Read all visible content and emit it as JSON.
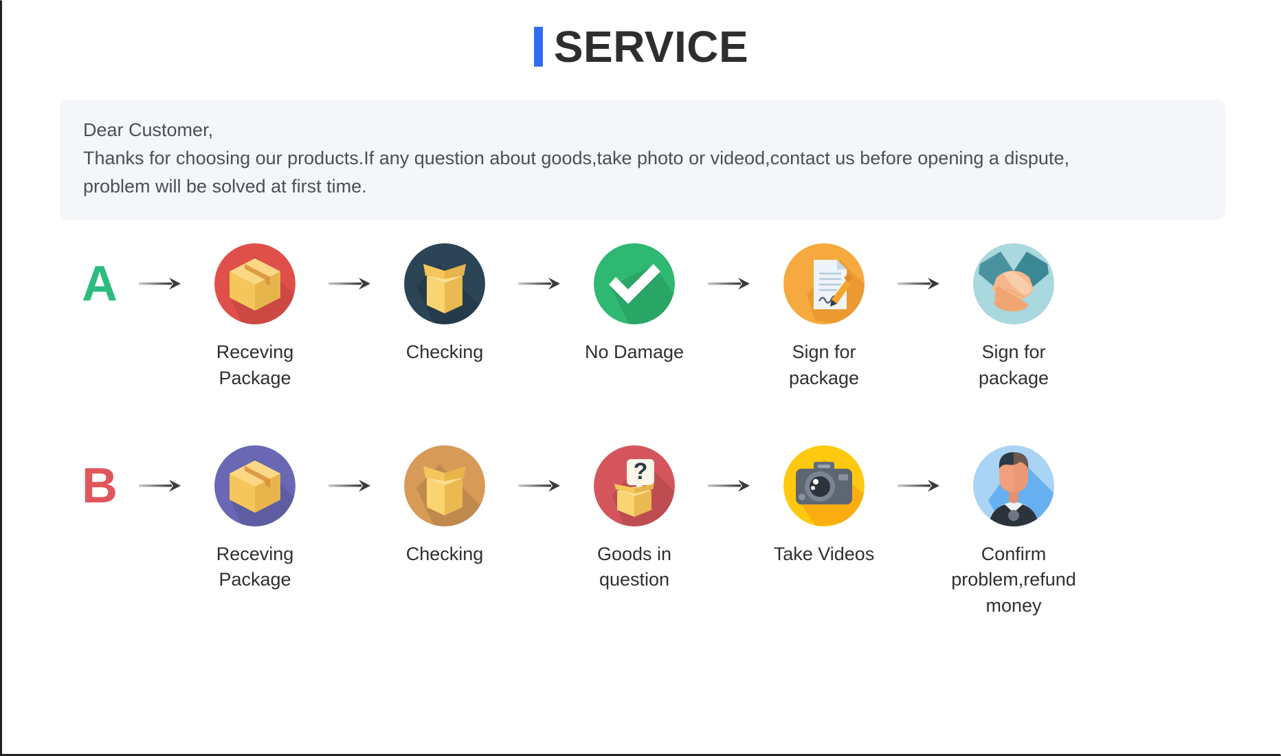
{
  "header": {
    "title": "SERVICE",
    "accent_color": "#2f6ef5"
  },
  "notice": {
    "line1": "Dear Customer,",
    "line2": "Thanks for choosing our products.If any question about goods,take photo or videod,contact us before opening a dispute,",
    "line3": "problem will be solved at first time.",
    "background_color": "#f4f6fa"
  },
  "flows": [
    {
      "letter": "A",
      "letter_color": "#2bbd7e",
      "steps": [
        {
          "label": "Receving Package",
          "icon": "closed-box-icon",
          "circle_color": "#e0504a"
        },
        {
          "label": "Checking",
          "icon": "open-box-icon",
          "circle_color": "#2b4456"
        },
        {
          "label": "No Damage",
          "icon": "checkmark-icon",
          "circle_color": "#2eb872"
        },
        {
          "label": "Sign for package",
          "icon": "signed-document-icon",
          "circle_color": "#f6a93e"
        },
        {
          "label": "Sign for package",
          "icon": "handshake-icon",
          "circle_color": "#a9d8de"
        }
      ]
    },
    {
      "letter": "B",
      "letter_color": "#e0565a",
      "steps": [
        {
          "label": "Receving Package",
          "icon": "closed-box-icon",
          "circle_color": "#6a68b4"
        },
        {
          "label": "Checking",
          "icon": "open-box-icon",
          "circle_color": "#d79a57"
        },
        {
          "label": "Goods in question",
          "icon": "question-box-icon",
          "circle_color": "#d4565c"
        },
        {
          "label": "Take Videos",
          "icon": "camera-icon",
          "circle_color": "#ffc910"
        },
        {
          "label": "Confirm problem,refund money",
          "icon": "support-agent-icon",
          "circle_color": "#a9d4f5"
        }
      ]
    }
  ],
  "arrow": {
    "name": "arrow-right-icon",
    "color": "#3b3b3b"
  }
}
